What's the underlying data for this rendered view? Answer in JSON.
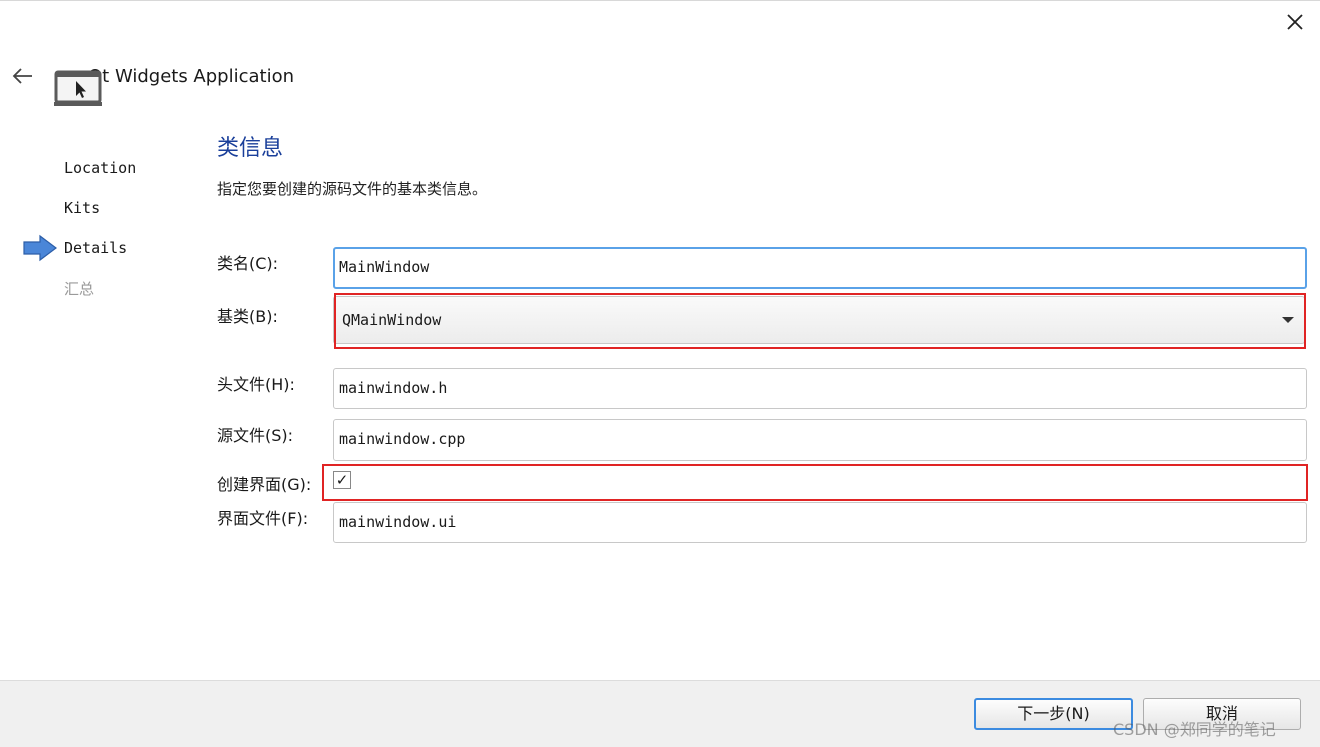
{
  "wizard": {
    "title": "Qt Widgets Application"
  },
  "steps": [
    {
      "label": "Location",
      "state": "done"
    },
    {
      "label": "Kits",
      "state": "done"
    },
    {
      "label": "Details",
      "state": "current"
    },
    {
      "label": "汇总",
      "state": "pending"
    }
  ],
  "section": {
    "title": "类信息",
    "description": "指定您要创建的源码文件的基本类信息。"
  },
  "form": {
    "class_name": {
      "label": "类名(C):",
      "value": "MainWindow"
    },
    "base_class": {
      "label": "基类(B):",
      "value": "QMainWindow"
    },
    "header_file": {
      "label": "头文件(H):",
      "value": "mainwindow.h"
    },
    "source_file": {
      "label": "源文件(S):",
      "value": "mainwindow.cpp"
    },
    "generate_form": {
      "label": "创建界面(G):",
      "checked": true,
      "check_glyph": "✓"
    },
    "form_file": {
      "label": "界面文件(F):",
      "value": "mainwindow.ui"
    }
  },
  "buttons": {
    "next": "下一步(N)",
    "cancel": "取消"
  },
  "watermark": "CSDN @郑同学的笔记",
  "colors": {
    "highlight": "#e02424",
    "section_title": "#1a3f9a",
    "focus": "#5aa2e8",
    "step_arrow": "#4a86d8"
  }
}
